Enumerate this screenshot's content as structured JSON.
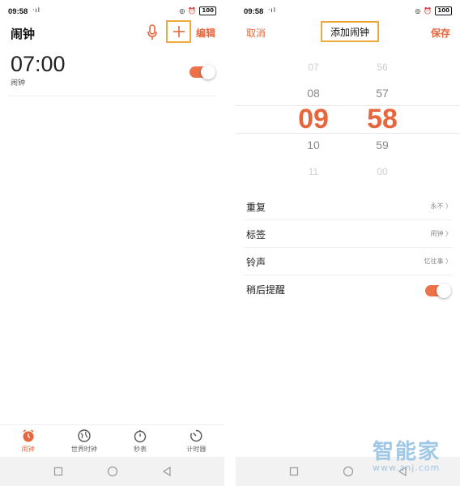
{
  "status_bar": {
    "time": "09:58",
    "signal": "·ıl",
    "battery": "100"
  },
  "left": {
    "title": "闹钟",
    "edit": "编辑",
    "alarm": {
      "time": "07:00",
      "label": "闹钟",
      "enabled": true
    },
    "tabs": [
      {
        "label": "闹钟",
        "icon": "alarm-clock-icon",
        "active": true
      },
      {
        "label": "世界时钟",
        "icon": "globe-icon",
        "active": false
      },
      {
        "label": "秒表",
        "icon": "stopwatch-icon",
        "active": false
      },
      {
        "label": "计时器",
        "icon": "timer-icon",
        "active": false
      }
    ]
  },
  "right": {
    "cancel": "取消",
    "title": "添加闹钟",
    "save": "保存",
    "picker": {
      "hours": [
        "07",
        "08",
        "09",
        "10",
        "11"
      ],
      "minutes": [
        "56",
        "57",
        "58",
        "59",
        "00"
      ]
    },
    "settings": [
      {
        "label": "重复",
        "value": "永不 〉"
      },
      {
        "label": "标签",
        "value": "闹钟 〉"
      },
      {
        "label": "铃声",
        "value": "忆往事 〉"
      },
      {
        "label": "稍后提醒",
        "toggle": true
      }
    ]
  },
  "watermark": {
    "text": "智能家",
    "url": "www.znj.com"
  },
  "colors": {
    "accent": "#e8663d",
    "highlight_box": "#f0a93b"
  }
}
